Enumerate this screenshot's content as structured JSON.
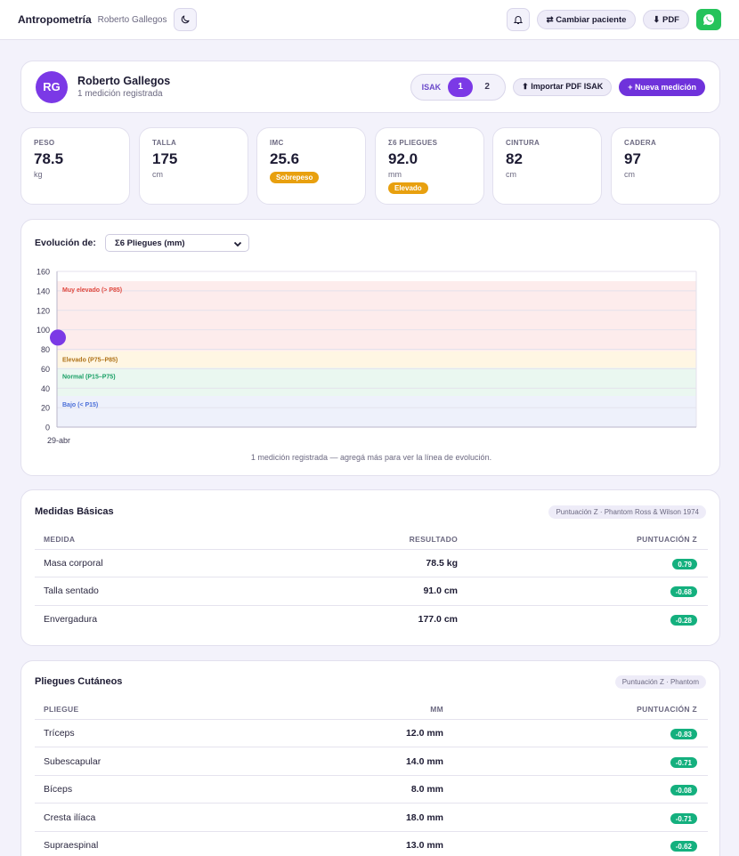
{
  "header": {
    "title": "Antropometría",
    "patient": "Roberto Gallegos",
    "change_patient_label": "⇄ Cambiar paciente",
    "pdf_label": "⬇ PDF"
  },
  "patient": {
    "initials": "RG",
    "name": "Roberto Gallegos",
    "meta": "1 medición registrada",
    "isak_label": "ISAK",
    "isak_options": [
      "1",
      "2"
    ],
    "isak_selected": "1",
    "import_label": "⬆ Importar PDF ISAK",
    "new_label": "+ Nueva medición"
  },
  "stats": [
    {
      "label": "PESO",
      "value": "78.5",
      "unit": "kg",
      "badge": ""
    },
    {
      "label": "TALLA",
      "value": "175",
      "unit": "cm",
      "badge": ""
    },
    {
      "label": "IMC",
      "value": "25.6",
      "unit": "",
      "badge": "Sobrepeso"
    },
    {
      "label": "Σ6 PLIEGUES",
      "value": "92.0",
      "unit": "mm",
      "badge": "Elevado"
    },
    {
      "label": "CINTURA",
      "value": "82",
      "unit": "cm",
      "badge": ""
    },
    {
      "label": "CADERA",
      "value": "97",
      "unit": "cm",
      "badge": ""
    }
  ],
  "evolution": {
    "label": "Evolución de:",
    "selected": "Σ6 Pliegues (mm)",
    "note": "1 medición registrada — agregá más para ver la línea de evolución."
  },
  "chart_data": {
    "type": "scatter",
    "x": [
      "29-abr"
    ],
    "y": [
      92
    ],
    "ylim": [
      0,
      160
    ],
    "yticks": [
      0,
      20,
      40,
      60,
      80,
      100,
      120,
      140,
      160
    ],
    "grid": true,
    "point_color": "#7b39e6",
    "bands": [
      {
        "label": "Muy elevado (> P85)",
        "from": 78,
        "to": 150,
        "fill": "#fdecec",
        "text_color": "#e0473d"
      },
      {
        "label": "Elevado (P75–P85)",
        "from": 61,
        "to": 78,
        "fill": "#fff6e3",
        "text_color": "#b0741a"
      },
      {
        "label": "Normal (P15–P75)",
        "from": 32,
        "to": 61,
        "fill": "#eaf7f0",
        "text_color": "#1aa066"
      },
      {
        "label": "Bajo (< P15)",
        "from": 0,
        "to": 32,
        "fill": "#eef1fb",
        "text_color": "#4b6fd8"
      }
    ]
  },
  "basic": {
    "title": "Medidas Básicas",
    "chip": "Puntuación Z · Phantom Ross & Wilson 1974",
    "columns": [
      "MEDIDA",
      "RESULTADO",
      "PUNTUACIÓN Z"
    ],
    "rows": [
      {
        "name": "Masa corporal",
        "value": "78.5 kg",
        "z": "0.79"
      },
      {
        "name": "Talla sentado",
        "value": "91.0 cm",
        "z": "-0.68"
      },
      {
        "name": "Envergadura",
        "value": "177.0 cm",
        "z": "-0.28"
      }
    ]
  },
  "skinfolds": {
    "title": "Pliegues Cutáneos",
    "chip": "Puntuación Z · Phantom",
    "columns": [
      "PLIEGUE",
      "MM",
      "PUNTUACIÓN Z"
    ],
    "rows": [
      {
        "name": "Tríceps",
        "value": "12.0 mm",
        "z": "-0.83"
      },
      {
        "name": "Subescapular",
        "value": "14.0 mm",
        "z": "-0.71"
      },
      {
        "name": "Bíceps",
        "value": "8.0 mm",
        "z": "-0.08"
      },
      {
        "name": "Cresta ilíaca",
        "value": "18.0 mm",
        "z": "-0.71"
      },
      {
        "name": "Supraespinal",
        "value": "13.0 mm",
        "z": "-0.62"
      }
    ]
  },
  "colors": {
    "accent": "#7b39e6",
    "success": "#14b07e",
    "warning": "#e8a00f"
  }
}
